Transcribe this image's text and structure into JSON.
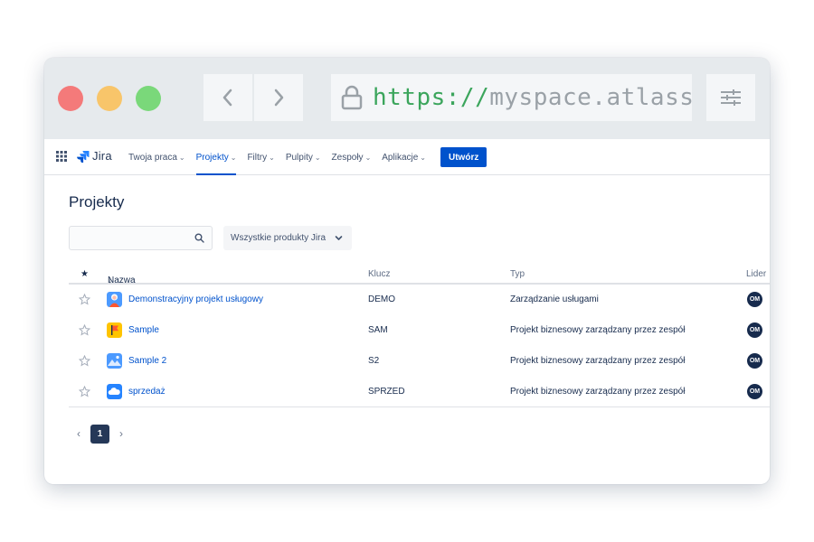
{
  "browser": {
    "url_scheme": "https://",
    "url_host": "myspace.atlassian.net"
  },
  "nav": {
    "product": "Jira",
    "items": [
      {
        "label": "Twoja praca"
      },
      {
        "label": "Projekty"
      },
      {
        "label": "Filtry"
      },
      {
        "label": "Pulpity"
      },
      {
        "label": "Zespoły"
      },
      {
        "label": "Aplikacje"
      }
    ],
    "active": "Projekty",
    "create_label": "Utwórz",
    "accent": "#0052cc"
  },
  "page": {
    "title": "Projekty",
    "search_placeholder": "",
    "filter_label": "Wszystkie produkty Jira"
  },
  "table": {
    "headers": {
      "star": "★",
      "name": "Nazwa",
      "name_sort": "↓",
      "key": "Klucz",
      "type": "Typ",
      "lead": "Lider"
    },
    "rows": [
      {
        "name": "Demonstracyjny projekt usługowy",
        "key": "DEMO",
        "type": "Zarządzanie usługami",
        "lead": "OM",
        "icon": "service-project-icon"
      },
      {
        "name": "Sample",
        "key": "SAM",
        "type": "Projekt biznesowy zarządzany przez zespół",
        "lead": "OM",
        "icon": "flag-project-icon"
      },
      {
        "name": "Sample 2",
        "key": "S2",
        "type": "Projekt biznesowy zarządzany przez zespół",
        "lead": "OM",
        "icon": "mountain-project-icon"
      },
      {
        "name": "sprzedaż",
        "key": "SPRZED",
        "type": "Projekt biznesowy zarządzany przez zespół",
        "lead": "OM",
        "icon": "cloud-project-icon"
      }
    ]
  },
  "pagination": {
    "current_page": "1"
  }
}
